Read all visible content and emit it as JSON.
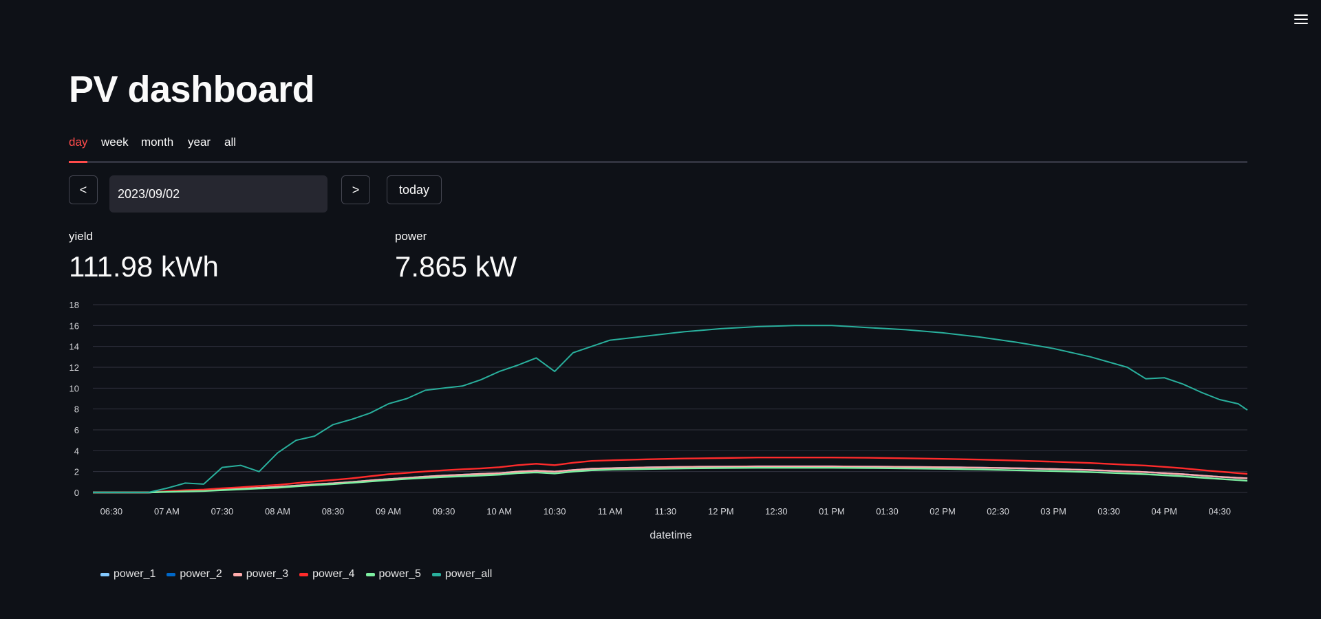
{
  "page": {
    "title": "PV dashboard"
  },
  "tabs": [
    {
      "label": "day",
      "active": true
    },
    {
      "label": "week",
      "active": false
    },
    {
      "label": "month",
      "active": false
    },
    {
      "label": "year",
      "active": false
    },
    {
      "label": "all",
      "active": false
    }
  ],
  "controls": {
    "prev_label": "<",
    "date_value": "2023/09/02",
    "next_label": ">",
    "today_label": "today"
  },
  "metrics": {
    "yield": {
      "label": "yield",
      "value": "111.98 kWh"
    },
    "power": {
      "label": "power",
      "value": "7.865 kW"
    }
  },
  "icons": {
    "menu": "hamburger-menu-icon"
  },
  "colors": {
    "accent": "#ff4b4b",
    "background": "#0e1117",
    "power_1": "#83c9ff",
    "power_2": "#0068c9",
    "power_3": "#ffabab",
    "power_4": "#ff2b2b",
    "power_5": "#7defa1",
    "power_all": "#29b09d"
  },
  "chart_data": {
    "type": "line",
    "xlabel": "datetime",
    "ylabel": "",
    "ylim": [
      0,
      18
    ],
    "yticks": [
      0,
      2,
      4,
      6,
      8,
      10,
      12,
      14,
      16,
      18
    ],
    "xlim": [
      "06:20",
      "16:45"
    ],
    "xticks": [
      {
        "t": "06:30",
        "label": "06:30"
      },
      {
        "t": "07:00",
        "label": "07 AM"
      },
      {
        "t": "07:30",
        "label": "07:30"
      },
      {
        "t": "08:00",
        "label": "08 AM"
      },
      {
        "t": "08:30",
        "label": "08:30"
      },
      {
        "t": "09:00",
        "label": "09 AM"
      },
      {
        "t": "09:30",
        "label": "09:30"
      },
      {
        "t": "10:00",
        "label": "10 AM"
      },
      {
        "t": "10:30",
        "label": "10:30"
      },
      {
        "t": "11:00",
        "label": "11 AM"
      },
      {
        "t": "11:30",
        "label": "11:30"
      },
      {
        "t": "12:00",
        "label": "12 PM"
      },
      {
        "t": "12:30",
        "label": "12:30"
      },
      {
        "t": "13:00",
        "label": "01 PM"
      },
      {
        "t": "13:30",
        "label": "01:30"
      },
      {
        "t": "14:00",
        "label": "02 PM"
      },
      {
        "t": "14:30",
        "label": "02:30"
      },
      {
        "t": "15:00",
        "label": "03 PM"
      },
      {
        "t": "15:30",
        "label": "03:30"
      },
      {
        "t": "16:00",
        "label": "04 PM"
      },
      {
        "t": "16:30",
        "label": "04:30"
      }
    ],
    "grid": true,
    "legend": "bottom-left",
    "x": [
      "06:20",
      "06:50",
      "07:00",
      "07:10",
      "07:20",
      "07:30",
      "07:40",
      "07:50",
      "08:00",
      "08:10",
      "08:20",
      "08:30",
      "08:40",
      "08:50",
      "09:00",
      "09:10",
      "09:20",
      "09:30",
      "09:40",
      "09:50",
      "10:00",
      "10:10",
      "10:20",
      "10:30",
      "10:40",
      "10:50",
      "11:00",
      "11:20",
      "11:40",
      "12:00",
      "12:20",
      "12:40",
      "13:00",
      "13:20",
      "13:40",
      "14:00",
      "14:20",
      "14:40",
      "15:00",
      "15:20",
      "15:40",
      "15:50",
      "16:00",
      "16:10",
      "16:20",
      "16:30",
      "16:40",
      "16:45"
    ],
    "series": [
      {
        "name": "power_1",
        "values": [
          0,
          0,
          0.08,
          0.15,
          0.18,
          0.28,
          0.35,
          0.45,
          0.53,
          0.65,
          0.78,
          0.88,
          1.0,
          1.15,
          1.28,
          1.4,
          1.52,
          1.62,
          1.7,
          1.78,
          1.85,
          2.0,
          2.08,
          2.0,
          2.15,
          2.28,
          2.32,
          2.4,
          2.45,
          2.48,
          2.5,
          2.5,
          2.5,
          2.48,
          2.45,
          2.42,
          2.38,
          2.32,
          2.25,
          2.15,
          2.02,
          1.95,
          1.85,
          1.75,
          1.62,
          1.5,
          1.4,
          1.36
        ]
      },
      {
        "name": "power_2",
        "values": [
          0,
          0,
          0.08,
          0.15,
          0.18,
          0.28,
          0.35,
          0.45,
          0.53,
          0.65,
          0.78,
          0.88,
          1.0,
          1.15,
          1.28,
          1.4,
          1.52,
          1.62,
          1.7,
          1.78,
          1.85,
          2.0,
          2.08,
          2.0,
          2.15,
          2.28,
          2.32,
          2.4,
          2.45,
          2.48,
          2.5,
          2.5,
          2.5,
          2.48,
          2.45,
          2.42,
          2.38,
          2.32,
          2.25,
          2.15,
          2.02,
          1.95,
          1.85,
          1.75,
          1.62,
          1.5,
          1.4,
          1.36
        ]
      },
      {
        "name": "power_3",
        "values": [
          0,
          0,
          0.08,
          0.15,
          0.18,
          0.28,
          0.35,
          0.45,
          0.53,
          0.65,
          0.78,
          0.88,
          1.0,
          1.15,
          1.28,
          1.4,
          1.52,
          1.62,
          1.7,
          1.78,
          1.85,
          2.0,
          2.08,
          2.0,
          2.15,
          2.28,
          2.32,
          2.4,
          2.45,
          2.48,
          2.5,
          2.5,
          2.5,
          2.48,
          2.45,
          2.42,
          2.38,
          2.32,
          2.25,
          2.15,
          2.02,
          1.95,
          1.85,
          1.75,
          1.62,
          1.5,
          1.4,
          1.36
        ]
      },
      {
        "name": "power_4",
        "values": [
          0,
          0,
          0.12,
          0.22,
          0.28,
          0.4,
          0.5,
          0.62,
          0.72,
          0.9,
          1.05,
          1.2,
          1.35,
          1.55,
          1.75,
          1.88,
          2.02,
          2.12,
          2.22,
          2.3,
          2.42,
          2.62,
          2.75,
          2.62,
          2.85,
          3.02,
          3.08,
          3.18,
          3.25,
          3.3,
          3.35,
          3.35,
          3.35,
          3.32,
          3.28,
          3.22,
          3.15,
          3.05,
          2.95,
          2.82,
          2.65,
          2.58,
          2.45,
          2.32,
          2.15,
          2.0,
          1.85,
          1.78
        ]
      },
      {
        "name": "power_5",
        "values": [
          0,
          0,
          0.05,
          0.1,
          0.14,
          0.22,
          0.3,
          0.38,
          0.45,
          0.58,
          0.7,
          0.8,
          0.92,
          1.05,
          1.18,
          1.3,
          1.4,
          1.48,
          1.55,
          1.62,
          1.7,
          1.85,
          1.92,
          1.82,
          2.0,
          2.12,
          2.18,
          2.25,
          2.3,
          2.34,
          2.36,
          2.36,
          2.36,
          2.34,
          2.3,
          2.26,
          2.2,
          2.12,
          2.05,
          1.95,
          1.82,
          1.75,
          1.65,
          1.55,
          1.42,
          1.3,
          1.18,
          1.12
        ]
      },
      {
        "name": "power_all",
        "values": [
          0,
          0,
          0.4,
          0.9,
          0.8,
          2.4,
          2.6,
          2.0,
          3.8,
          5.0,
          5.4,
          6.5,
          7.0,
          7.6,
          8.5,
          9.0,
          9.8,
          10.0,
          10.2,
          10.8,
          11.6,
          12.2,
          12.9,
          11.6,
          13.4,
          14.0,
          14.6,
          15.0,
          15.4,
          15.7,
          15.9,
          16.0,
          16.0,
          15.8,
          15.6,
          15.3,
          14.9,
          14.4,
          13.8,
          13.0,
          12.0,
          10.9,
          11.0,
          10.4,
          9.6,
          8.9,
          8.5,
          7.9
        ]
      }
    ]
  }
}
